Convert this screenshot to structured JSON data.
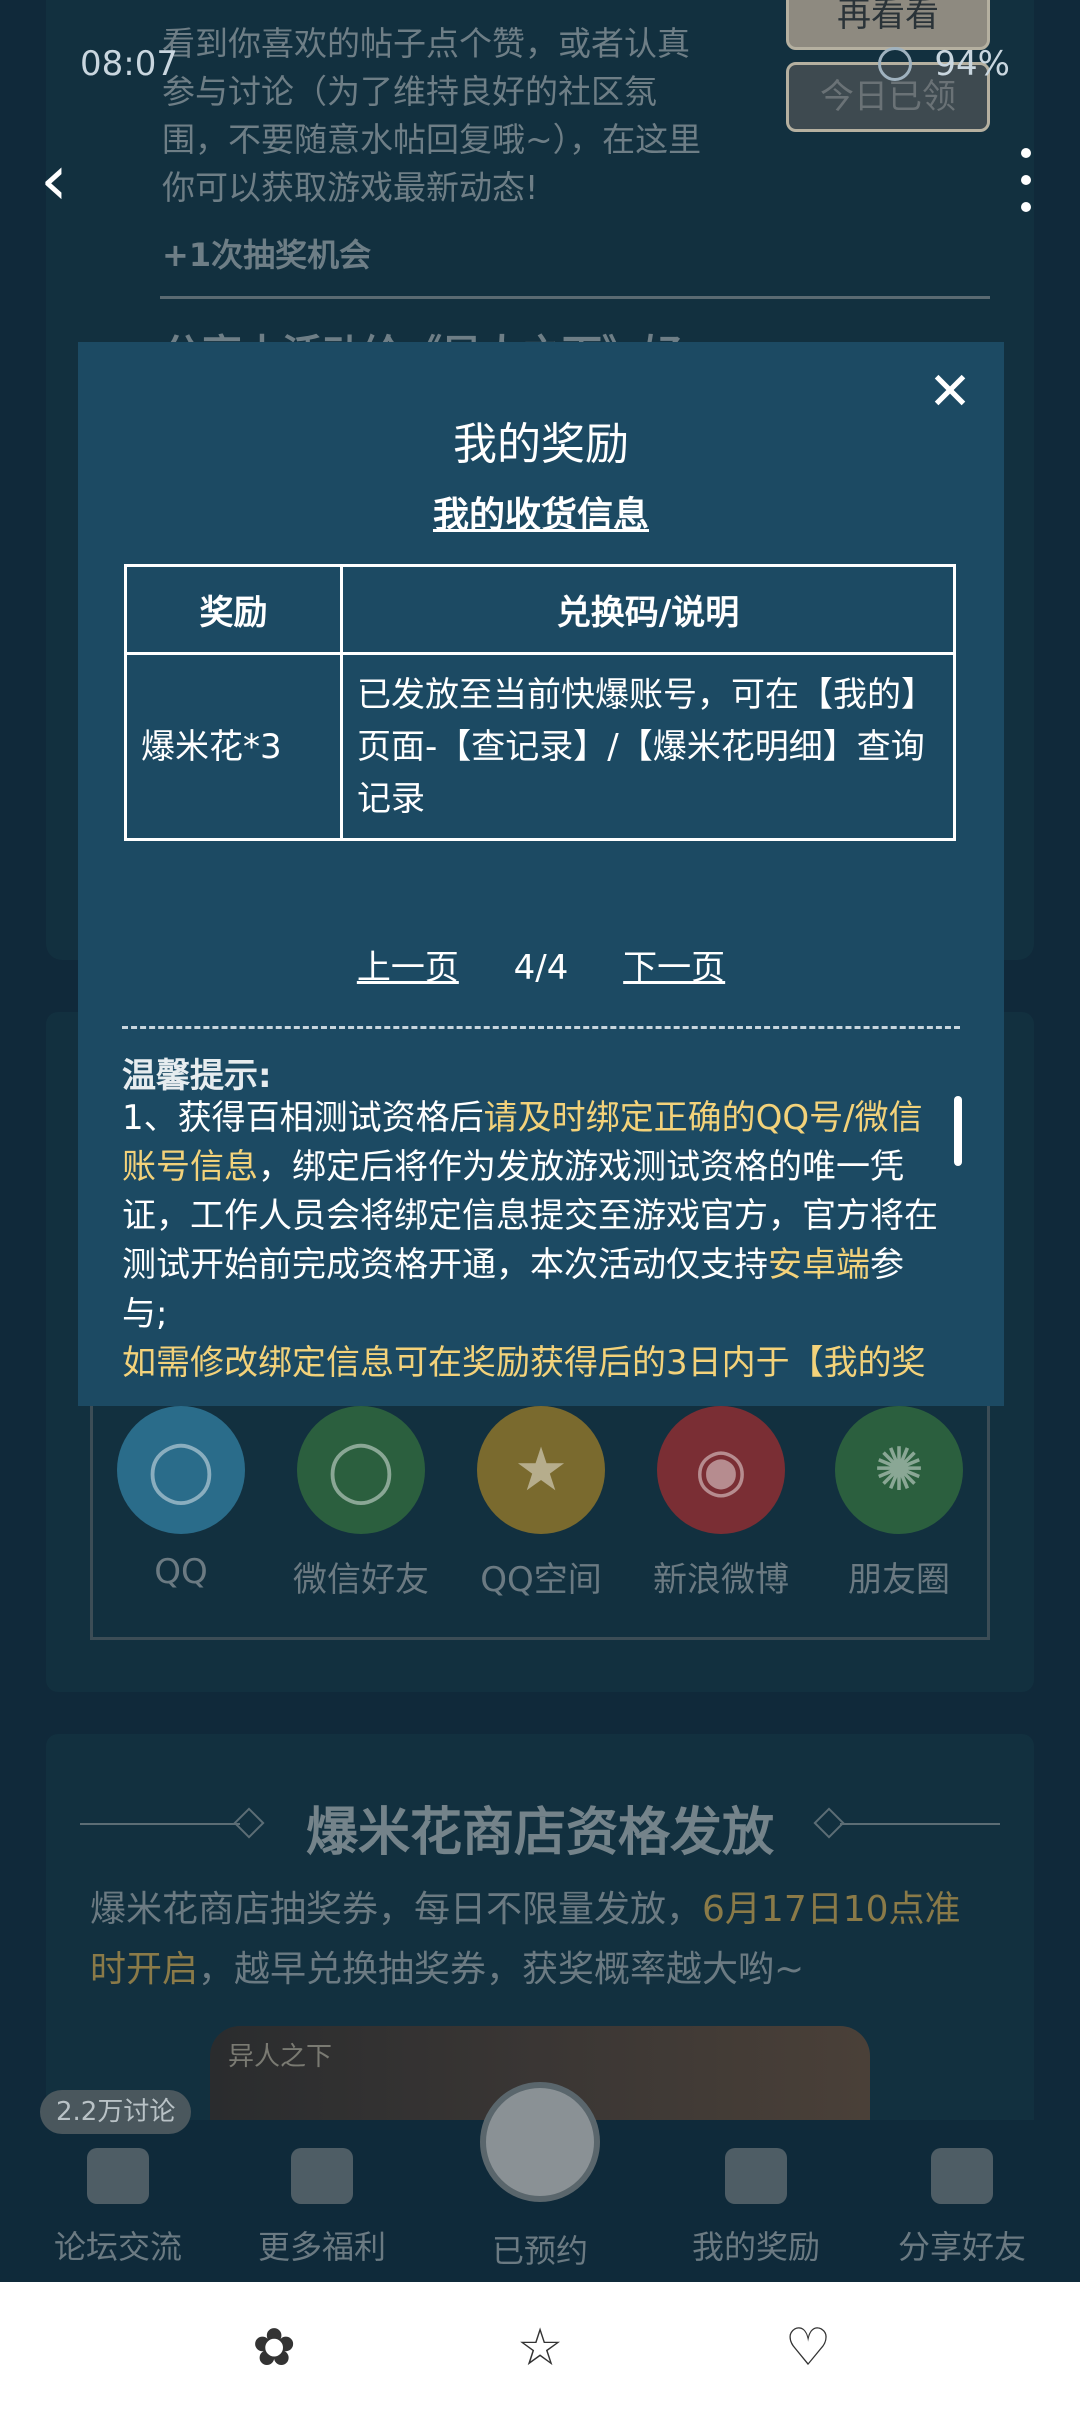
{
  "status": {
    "time": "08:07",
    "battery": "94%"
  },
  "background": {
    "task": {
      "btn_again": "再看看",
      "btn_claimed": "今日已领",
      "desc": "看到你喜欢的帖子点个赞，或者认真参与讨论（为了维持良好的社区氛围，不要随意水帖回复哦~），在这里你可以获取游戏最新动态!",
      "chance": "+1次抽奖机会",
      "next_title": "分享本活动给《异人之下》好"
    },
    "share": {
      "items": [
        {
          "label": "QQ",
          "color": "#2a6c8a",
          "icon": "qq-icon"
        },
        {
          "label": "微信好友",
          "color": "#2b5f3e",
          "icon": "wechat-icon"
        },
        {
          "label": "QQ空间",
          "color": "#7a6a2e",
          "icon": "qzone-icon"
        },
        {
          "label": "新浪微博",
          "color": "#7a2e34",
          "icon": "weibo-icon"
        },
        {
          "label": "朋友圈",
          "color": "#2b5f3e",
          "icon": "moments-icon"
        }
      ]
    },
    "shop": {
      "title": "爆米花商店资格发放",
      "desc_a": "爆米花商店抽奖券，每日不限量发放，",
      "desc_hl": "6月17日10点准时开启",
      "desc_b": "，越早兑换抽奖券，获奖概率越大哟~",
      "banner_label": "异人之下"
    },
    "tabs": {
      "discuss_badge": "2.2万讨论",
      "items": [
        "论坛交流",
        "更多福利",
        "已预约",
        "我的奖励",
        "分享好友"
      ]
    }
  },
  "modal": {
    "title": "我的奖励",
    "subtitle": "我的收货信息",
    "table": {
      "headers": [
        "奖励",
        "兑换码/说明"
      ],
      "rows": [
        {
          "reward": "爆米花*3",
          "note": "已发放至当前快爆账号，可在【我的】页面-【查记录】/【爆米花明细】查询记录"
        }
      ]
    },
    "pager": {
      "prev": "上一页",
      "current": "4/4",
      "next": "下一页"
    },
    "tips": {
      "title": "温馨提示:",
      "p1_a": "1、获得百相测试资格后",
      "p1_hl": "请及时绑定正确的QQ号/微信账号信息",
      "p1_b": "，绑定后将作为发放游戏测试资格的唯一凭证，工作人员会将绑定信息提交至游戏官方，官方将在测试开始前完成资格开通，本次活动仅支持",
      "p1_hl2": "安卓端",
      "p1_c": "参与;",
      "p2_hl": "如需修改绑定信息可在奖励获得后的3日内于【我的奖"
    }
  }
}
